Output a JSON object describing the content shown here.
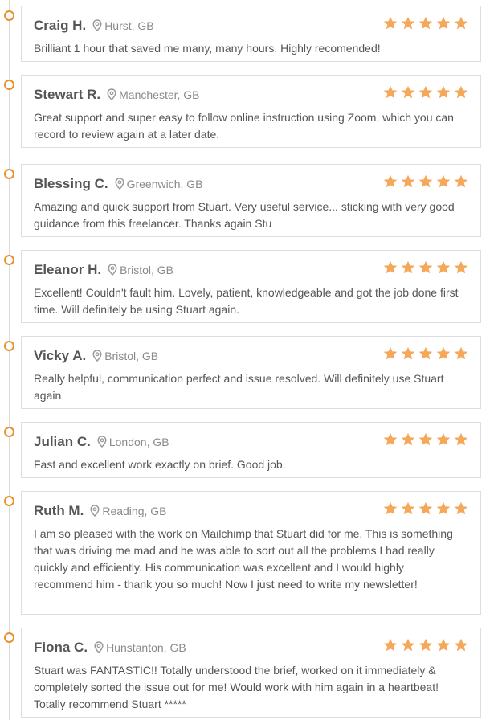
{
  "colors": {
    "accent": "#e8902c",
    "star": "#f5a85a",
    "text": "#555555",
    "muted": "#8a8a8a",
    "border": "#dedede"
  },
  "icons": {
    "location": "map-pin-icon",
    "rating": "star-icon",
    "timeline": "timeline-dot-icon"
  },
  "reviews": [
    {
      "name": "Craig H.",
      "location": "Hurst, GB",
      "rating": 5,
      "text": "Brilliant 1 hour that saved me many, many hours. Highly recomended!"
    },
    {
      "name": "Stewart R.",
      "location": "Manchester, GB",
      "rating": 5,
      "text": "Great support and super easy to follow online instruction using Zoom, which you can record to review again at a later date."
    },
    {
      "name": "Blessing C.",
      "location": "Greenwich, GB",
      "rating": 5,
      "text": "Amazing and quick support from Stuart. Very useful service... sticking with very good guidance from this freelancer. Thanks again Stu"
    },
    {
      "name": "Eleanor H.",
      "location": "Bristol, GB",
      "rating": 5,
      "text": "Excellent! Couldn't fault him. Lovely, patient, knowledgeable and got the job done first time. Will definitely be using Stuart again."
    },
    {
      "name": "Vicky A.",
      "location": "Bristol, GB",
      "rating": 5,
      "text": "Really helpful, communication perfect and issue resolved. Will definitely use Stuart again"
    },
    {
      "name": "Julian C.",
      "location": "London, GB",
      "rating": 5,
      "text": "Fast and excellent work exactly on brief. Good job."
    },
    {
      "name": "Ruth M.",
      "location": "Reading, GB",
      "rating": 5,
      "text": "I am so pleased with the work on Mailchimp that Stuart did for me. This is something that was driving me mad and he was able to sort out all the problems I had really quickly and efficiently. His communication was excellent and I would highly recommend him - thank you so much! Now I just need to write my newsletter!"
    },
    {
      "name": "Fiona C.",
      "location": "Hunstanton, GB",
      "rating": 5,
      "text": "Stuart was FANTASTIC!! Totally understood the brief, worked on it immediately & completely sorted the issue out for me! Would work with him again in a heartbeat! Totally recommend Stuart *****"
    }
  ]
}
